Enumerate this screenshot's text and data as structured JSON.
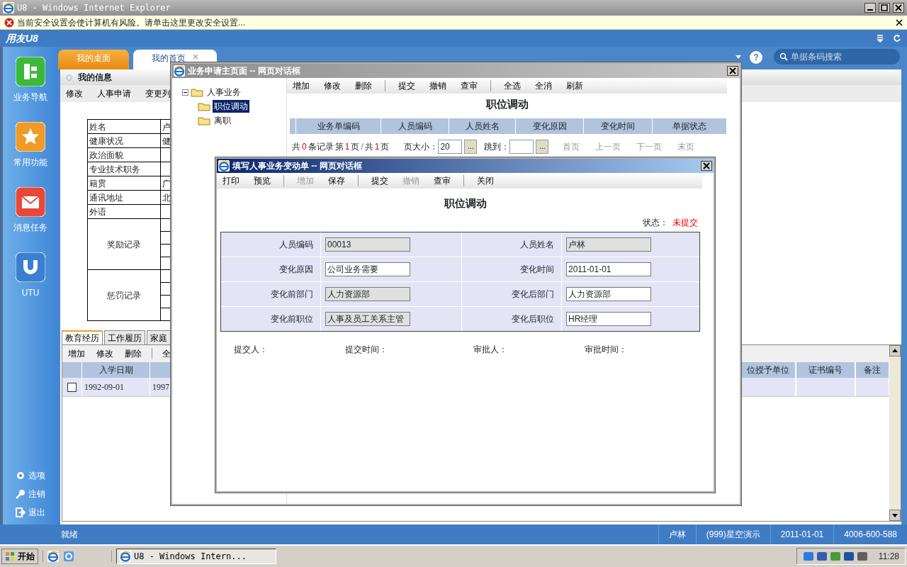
{
  "browser": {
    "title": "U8 - Windows Internet Explorer",
    "security_bar": "当前安全设置会使计算机有风险。请单击这里更改安全设置..."
  },
  "app": {
    "logo": "用友U8",
    "help": "?",
    "search": {
      "placeholder": "单据条码搜索"
    }
  },
  "sidebar": {
    "items": [
      {
        "label": "业务导航",
        "kind": "nav"
      },
      {
        "label": "常用功能",
        "kind": "favorite"
      },
      {
        "label": "消息任务",
        "kind": "message"
      },
      {
        "label": "UTU",
        "kind": "utu"
      }
    ],
    "links": [
      {
        "label": "选项",
        "kind": "options"
      },
      {
        "label": "注销",
        "kind": "logout"
      },
      {
        "label": "退出",
        "kind": "exit"
      }
    ]
  },
  "tabs": [
    {
      "label": "我的桌面",
      "selected": false,
      "closable": false
    },
    {
      "label": "我的首页",
      "selected": true,
      "closable": true
    }
  ],
  "panel": {
    "title": "我的信息",
    "toolbar": [
      "修改",
      "人事申请",
      "变更列"
    ],
    "info_rows": [
      {
        "label": "姓名",
        "value": "卢"
      },
      {
        "label": "健康状况",
        "value": "健"
      },
      {
        "label": "政治面貌"
      },
      {
        "label": "专业技术职务"
      },
      {
        "label": "籍贯",
        "value": "广"
      },
      {
        "label": "通讯地址",
        "value": "北"
      },
      {
        "label": "外语"
      }
    ],
    "record_groups": [
      "奖励记录",
      "惩罚记录"
    ]
  },
  "detail": {
    "tabs": [
      {
        "label": "教育经历",
        "selected": true
      },
      {
        "label": "工作履历",
        "selected": false
      },
      {
        "label": "家庭",
        "selected": false
      }
    ],
    "toolbar": [
      [
        "增加",
        "修改",
        "删除"
      ],
      [
        "全"
      ]
    ],
    "columns_left": [
      "入学日期"
    ],
    "columns_right": [
      "位授予单位",
      "证书编号",
      "备注"
    ],
    "rows": [
      {
        "checked": false,
        "cells": [
          "1992-09-01",
          "1997"
        ]
      }
    ]
  },
  "status_bar": {
    "text": "就绪",
    "user": "卢林",
    "account": "(999)星空演示",
    "date": "2011-01-01",
    "phone": "4006-600-588"
  },
  "taskbar": {
    "start": "开始",
    "tasks": [
      {
        "label": "U8 - Windows Intern...",
        "selected": true
      }
    ],
    "clock": "11:28"
  },
  "dialog_main": {
    "title": "业务申请主页面 -- 网页对话框",
    "tree": [
      {
        "label": "人事业务",
        "expanded": true,
        "selected": false,
        "children": [
          {
            "label": "职位调动",
            "selected": true
          },
          {
            "label": "离职",
            "selected": false
          }
        ]
      }
    ],
    "toolbar": [
      [
        "增加",
        "修改",
        "删除"
      ],
      [
        "提交",
        "撤销",
        "查审"
      ],
      [
        "全选",
        "全消",
        "刷新"
      ]
    ],
    "heading": "职位调动",
    "columns": [
      "业务单编码",
      "人员编码",
      "人员姓名",
      "变化原因",
      "变化时间",
      "单据状态"
    ],
    "pager": {
      "summary": [
        {
          "text": "共",
          "kind": "label"
        },
        {
          "text": "0",
          "kind": "number"
        },
        {
          "text": "条记录",
          "kind": "label"
        },
        {
          "text": "第",
          "kind": "label"
        },
        {
          "text": "1",
          "kind": "number"
        },
        {
          "text": "页",
          "kind": "label"
        },
        {
          "text": "/",
          "kind": "sep"
        },
        {
          "text": "共",
          "kind": "label"
        },
        {
          "text": "1",
          "kind": "number"
        },
        {
          "text": "页",
          "kind": "label"
        }
      ],
      "page_size": {
        "label": "页大小：",
        "value": "20",
        "button": "..."
      },
      "jump": {
        "label": "跳到：",
        "button": "..."
      },
      "nav": [
        {
          "label": "首页",
          "disabled": true
        },
        {
          "label": "上一页",
          "disabled": true
        },
        {
          "label": "下一页",
          "disabled": true
        },
        {
          "label": "末页",
          "disabled": true
        }
      ]
    }
  },
  "dialog_form": {
    "title": "填写人事业务变动单 -- 网页对话框",
    "toolbar": [
      [
        {
          "label": "打印",
          "disabled": false
        },
        {
          "label": "预览",
          "disabled": false
        }
      ],
      [
        {
          "label": "增加",
          "disabled": true
        },
        {
          "label": "保存",
          "disabled": false
        }
      ],
      [
        {
          "label": "提交",
          "disabled": false
        },
        {
          "label": "撤销",
          "disabled": true
        },
        {
          "label": "查审",
          "disabled": false
        }
      ],
      [
        {
          "label": "关闭",
          "disabled": false
        }
      ]
    ],
    "heading": "职位调动",
    "status": {
      "label": "状态：",
      "value": "未提交"
    },
    "fields": [
      {
        "label": "人员编码",
        "value": "00013",
        "readonly": true
      },
      {
        "label": "人员姓名",
        "value": "卢林",
        "readonly": true
      },
      {
        "label": "变化原因",
        "value": "公司业务需要",
        "readonly": false
      },
      {
        "label": "变化时间",
        "value": "2011-01-01",
        "readonly": false
      },
      {
        "label": "变化前部门",
        "value": "人力资源部",
        "readonly": true
      },
      {
        "label": "变化后部门",
        "value": "人力资源部",
        "readonly": false
      },
      {
        "label": "变化前职位",
        "value": "人事及员工关系主管",
        "readonly": true
      },
      {
        "label": "变化后职位",
        "value": "HR经理",
        "readonly": false
      }
    ],
    "footer": [
      "提交人：",
      "提交时间：",
      "审批人：",
      "审批时间："
    ]
  }
}
